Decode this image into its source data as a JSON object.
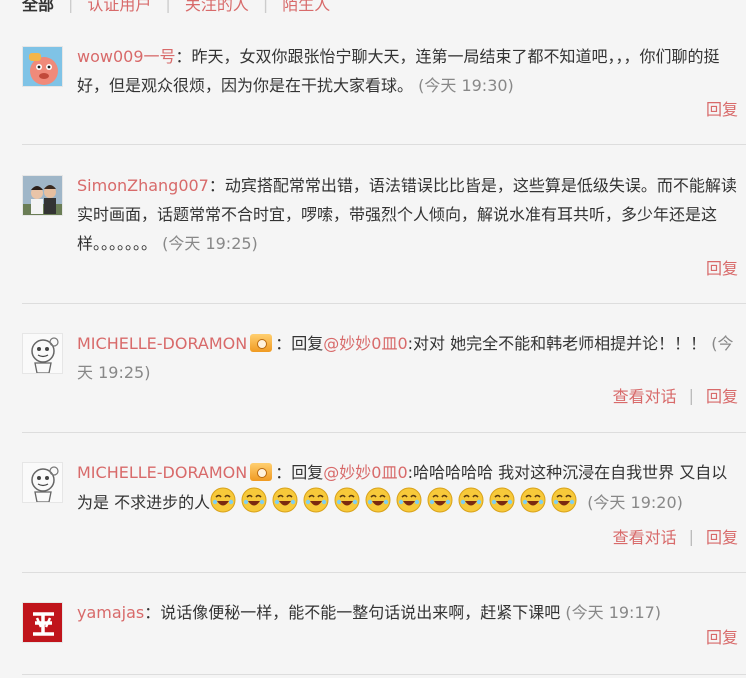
{
  "tabs": [
    {
      "label": "全部",
      "active": true
    },
    {
      "label": "认证用户",
      "active": false
    },
    {
      "label": "关注的人",
      "active": false
    },
    {
      "label": "陌生人",
      "active": false
    }
  ],
  "comments": [
    {
      "user": "wow009一号",
      "text": "：昨天，女双你跟张怡宁聊大天，连第一局结束了都不知道吧，，，你们聊的挺好，但是观众很烦，因为你是在干扰大家看球。",
      "time": "(今天 19:30)",
      "actions": [
        "回复"
      ]
    },
    {
      "user": "SimonZhang007",
      "text": "：动宾搭配常常出错，语法错误比比皆是，这些算是低级失误。而不能解读实时画面，话题常常不合时宜，啰嗦，带强烈个人倾向，解说水准有耳共听，多少年还是这样。。。。。。。",
      "time": "(今天 19:25)",
      "actions": [
        "回复"
      ]
    },
    {
      "user": "MICHELLE-DORAMON",
      "prefix": "：回复",
      "mention": "@妙妙0皿0",
      "text": ":对对 她完全不能和韩老师相提并论！！！",
      "time": "(今天 19:25)",
      "actions": [
        "查看对话",
        "回复"
      ]
    },
    {
      "user": "MICHELLE-DORAMON",
      "prefix": "：回复",
      "mention": "@妙妙0皿0",
      "text": ":哈哈哈哈哈 我对这种沉浸在自我世界 又自以为是 不求进步的人",
      "time": "(今天 19:20)",
      "actions": [
        "查看对话",
        "回复"
      ]
    },
    {
      "user": "yamajas",
      "text": "：说话像便秘一样，能不能一整句话说出来啊，赶紧下课吧",
      "time": "(今天 19:17)",
      "actions": [
        "回复"
      ]
    }
  ],
  "colors": {
    "link": "#d86a6a",
    "time": "#888888",
    "divider": "#dddddd",
    "background": "#f5f5f5"
  },
  "icons": {
    "vip": "vip-badge-icon",
    "emoji": "laughing-emoji-icon"
  }
}
